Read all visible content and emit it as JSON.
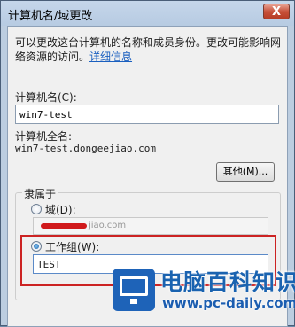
{
  "window": {
    "title": "计算机名/域更改",
    "close_label": "X"
  },
  "description": {
    "text": "可以更改这台计算机的名称和成员身份。更改可能影响网络资源的访问。",
    "link_text": "详细信息"
  },
  "computer_name": {
    "label": "计算机名(C):",
    "value": "win7-test"
  },
  "full_name": {
    "label": "计算机全名:",
    "value": "win7-test.dongeejiao.com"
  },
  "more_button": "其他(M)...",
  "member_of": {
    "legend": "隶属于",
    "domain": {
      "label": "域(D):",
      "value": "jiao.com",
      "selected": false
    },
    "workgroup": {
      "label": "工作组(W):",
      "value": "TEST",
      "selected": true
    }
  },
  "watermark": {
    "title": "电脑百科知识",
    "url": "www.pc-daily.com",
    "accent": "#1e63b8"
  },
  "colors": {
    "highlight_outline": "#cc2323"
  }
}
